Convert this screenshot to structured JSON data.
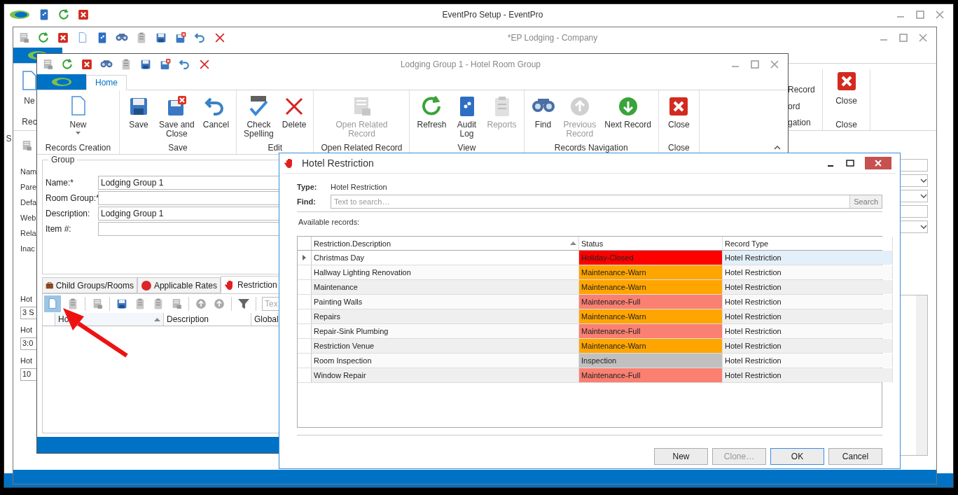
{
  "app_window": {
    "title": "EventPro Setup - EventPro",
    "edge_letter": "S"
  },
  "company_window": {
    "title": "*EP Lodging - Company",
    "new_button": "Ne",
    "group_label": "Rec",
    "nav_lines": [
      "Record",
      "ord",
      "gation"
    ],
    "close_button": "Close",
    "close_group": "Close",
    "field_labels": [
      "Nam",
      "Pare",
      "Defa",
      "Web",
      "Rela",
      "Inac"
    ],
    "hotel_fields": [
      {
        "label": "Hot",
        "value": "3 S"
      },
      {
        "label": "Hot",
        "value": "3:0"
      },
      {
        "label": "Hot",
        "value": "10"
      }
    ]
  },
  "lodging_window": {
    "title": "Lodging Group 1 - Hotel Room Group",
    "tabs": [
      {
        "label": "Home",
        "selected": true
      }
    ],
    "ribbon_groups": [
      {
        "label": "Records Creation",
        "buttons": [
          {
            "label": "New",
            "disabled": false,
            "dropdown": true
          }
        ]
      },
      {
        "label": "Save",
        "buttons": [
          {
            "label": "Save",
            "disabled": false,
            "dropdown": false
          },
          {
            "label": "Save and\nClose",
            "disabled": false,
            "dropdown": false
          },
          {
            "label": "Cancel",
            "disabled": false,
            "dropdown": false
          }
        ]
      },
      {
        "label": "Edit",
        "buttons": [
          {
            "label": "Check\nSpelling",
            "disabled": false,
            "dropdown": false
          },
          {
            "label": "Delete",
            "disabled": false,
            "dropdown": false
          }
        ]
      },
      {
        "label": "Open Related Record",
        "buttons": [
          {
            "label": "Open Related\nRecord",
            "disabled": true,
            "dropdown": false
          }
        ]
      },
      {
        "label": "View",
        "buttons": [
          {
            "label": "Refresh",
            "disabled": false,
            "dropdown": false
          },
          {
            "label": "Audit\nLog",
            "disabled": false,
            "dropdown": false
          },
          {
            "label": "Reports",
            "disabled": true,
            "dropdown": false
          }
        ]
      },
      {
        "label": "Records Navigation",
        "buttons": [
          {
            "label": "Find",
            "disabled": false,
            "dropdown": false
          },
          {
            "label": "Previous\nRecord",
            "disabled": true,
            "dropdown": false
          },
          {
            "label": "Next Record",
            "disabled": false,
            "dropdown": false
          }
        ]
      },
      {
        "label": "Close",
        "buttons": [
          {
            "label": "Close",
            "disabled": false,
            "dropdown": false
          }
        ]
      }
    ],
    "group_box": {
      "title": "Group",
      "fields": [
        {
          "label": "Name:*",
          "value": "Lodging Group 1"
        },
        {
          "label": "Room Group:*"
        },
        {
          "label": "Description:",
          "value": "Lodging Group 1"
        },
        {
          "label": "Item #:"
        }
      ]
    },
    "detail_tabs": [
      {
        "label": "Child Groups/Rooms",
        "selected": false
      },
      {
        "label": "Applicable Rates",
        "selected": false
      },
      {
        "label": "Restriction",
        "selected": true
      }
    ],
    "toolbar_search": {
      "placeholder": "Tex"
    },
    "grid_columns": [
      {
        "label": "Ho",
        "sorted": true
      },
      {
        "label": "Description",
        "sorted": false
      },
      {
        "label": "Global",
        "sorted": false
      }
    ]
  },
  "dialog": {
    "title": "Hotel Restriction",
    "type_label": "Type:",
    "type_value": "Hotel Restriction",
    "find_label": "Find:",
    "find_field": {
      "placeholder": "Text to search…"
    },
    "search_button": "Search",
    "list_caption": "Available records:",
    "columns": [
      {
        "label": "Restriction.Description",
        "sorted": true
      },
      {
        "label": "Status",
        "sorted": false
      },
      {
        "label": "Record Type",
        "sorted": false
      }
    ],
    "rows": [
      {
        "description": "Christmas Day",
        "status": "Holiday-Closed",
        "color": "#ff0000",
        "record_type": "Hotel Restriction",
        "selected": true
      },
      {
        "description": "Hallway Lighting Renovation",
        "status": "Maintenance-Warn",
        "color": "#ffa500",
        "record_type": "Hotel Restriction",
        "selected": false
      },
      {
        "description": "Maintenance",
        "status": "Maintenance-Warn",
        "color": "#ffa500",
        "record_type": "Hotel Restriction",
        "selected": false
      },
      {
        "description": "Painting Walls",
        "status": "Maintenance-Full",
        "color": "#fa8072",
        "record_type": "Hotel Restriction",
        "selected": false
      },
      {
        "description": "Repairs",
        "status": "Maintenance-Warn",
        "color": "#ffa500",
        "record_type": "Hotel Restriction",
        "selected": false
      },
      {
        "description": "Repair-Sink Plumbing",
        "status": "Maintenance-Full",
        "color": "#fa8072",
        "record_type": "Hotel Restriction",
        "selected": false
      },
      {
        "description": "Restriction Venue",
        "status": "Maintenance-Warn",
        "color": "#ffa500",
        "record_type": "Hotel Restriction",
        "selected": false
      },
      {
        "description": "Room Inspection",
        "status": "Inspection",
        "color": "#c0c0c0",
        "record_type": "Hotel Restriction",
        "selected": false
      },
      {
        "description": "Window Repair",
        "status": "Maintenance-Full",
        "color": "#fa8072",
        "record_type": "Hotel Restriction",
        "selected": false
      }
    ],
    "buttons": [
      {
        "label": "New",
        "disabled": false,
        "default": false
      },
      {
        "label": "Clone…",
        "disabled": true,
        "default": false
      },
      {
        "label": "OK",
        "disabled": false,
        "default": true
      },
      {
        "label": "Cancel",
        "disabled": false,
        "default": false
      }
    ]
  }
}
